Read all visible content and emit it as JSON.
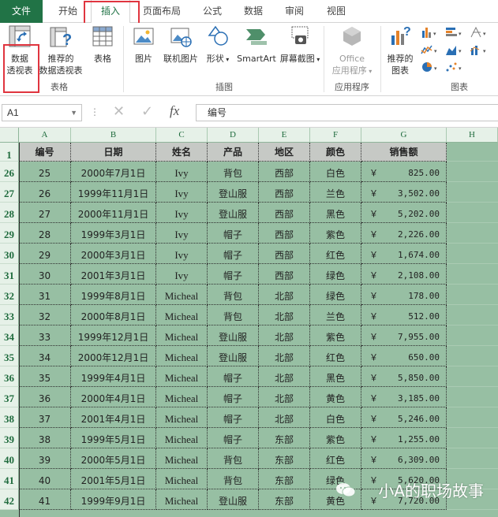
{
  "tabs": [
    {
      "label": "文件"
    },
    {
      "label": "开始"
    },
    {
      "label": "插入"
    },
    {
      "label": "页面布局"
    },
    {
      "label": "公式"
    },
    {
      "label": "数据"
    },
    {
      "label": "审阅"
    },
    {
      "label": "视图"
    }
  ],
  "ribbon": {
    "pivot_label_1": "数据",
    "pivot_label_2": "透视表",
    "rec_pivot_label_1": "推荐的",
    "rec_pivot_label_2": "数据透视表",
    "table_label": "表格",
    "group_table": "表格",
    "picture_label": "图片",
    "online_picture_label": "联机图片",
    "shapes_label": "形状",
    "smartart_label": "SmartArt",
    "screenshot_label": "屏幕截图",
    "group_illustrations": "插图",
    "office_apps_label_1": "Office",
    "office_apps_label_2": "应用程序",
    "group_apps": "应用程序",
    "rec_charts_label_1": "推荐的",
    "rec_charts_label_2": "图表",
    "group_charts": "图表"
  },
  "formula_bar": {
    "name_box": "A1",
    "fx": "fx",
    "content": "编号"
  },
  "columns": [
    "A",
    "B",
    "C",
    "D",
    "E",
    "F",
    "G",
    "H"
  ],
  "header_row": {
    "row": "1",
    "cells": [
      "编号",
      "日期",
      "姓名",
      "产品",
      "地区",
      "颜色",
      "销售额"
    ]
  },
  "rows": [
    {
      "row": "26",
      "cells": [
        "25",
        "2000年7月1日",
        "Ivy",
        "背包",
        "西部",
        "白色",
        "825.00"
      ]
    },
    {
      "row": "27",
      "cells": [
        "26",
        "1999年11月1日",
        "Ivy",
        "登山服",
        "西部",
        "兰色",
        "3,502.00"
      ]
    },
    {
      "row": "28",
      "cells": [
        "27",
        "2000年11月1日",
        "Ivy",
        "登山服",
        "西部",
        "黑色",
        "5,202.00"
      ]
    },
    {
      "row": "29",
      "cells": [
        "28",
        "1999年3月1日",
        "Ivy",
        "帽子",
        "西部",
        "紫色",
        "2,226.00"
      ]
    },
    {
      "row": "30",
      "cells": [
        "29",
        "2000年3月1日",
        "Ivy",
        "帽子",
        "西部",
        "红色",
        "1,674.00"
      ]
    },
    {
      "row": "31",
      "cells": [
        "30",
        "2001年3月1日",
        "Ivy",
        "帽子",
        "西部",
        "绿色",
        "2,108.00"
      ]
    },
    {
      "row": "32",
      "cells": [
        "31",
        "1999年8月1日",
        "Micheal",
        "背包",
        "北部",
        "绿色",
        "178.00"
      ]
    },
    {
      "row": "33",
      "cells": [
        "32",
        "2000年8月1日",
        "Micheal",
        "背包",
        "北部",
        "兰色",
        "512.00"
      ]
    },
    {
      "row": "34",
      "cells": [
        "33",
        "1999年12月1日",
        "Micheal",
        "登山服",
        "北部",
        "紫色",
        "7,955.00"
      ]
    },
    {
      "row": "35",
      "cells": [
        "34",
        "2000年12月1日",
        "Micheal",
        "登山服",
        "北部",
        "红色",
        "650.00"
      ]
    },
    {
      "row": "36",
      "cells": [
        "35",
        "1999年4月1日",
        "Micheal",
        "帽子",
        "北部",
        "黑色",
        "5,850.00"
      ]
    },
    {
      "row": "37",
      "cells": [
        "36",
        "2000年4月1日",
        "Micheal",
        "帽子",
        "北部",
        "黄色",
        "3,185.00"
      ]
    },
    {
      "row": "38",
      "cells": [
        "37",
        "2001年4月1日",
        "Micheal",
        "帽子",
        "北部",
        "白色",
        "5,246.00"
      ]
    },
    {
      "row": "39",
      "cells": [
        "38",
        "1999年5月1日",
        "Micheal",
        "帽子",
        "东部",
        "紫色",
        "1,255.00"
      ]
    },
    {
      "row": "40",
      "cells": [
        "39",
        "2000年5月1日",
        "Micheal",
        "背包",
        "东部",
        "红色",
        "6,309.00"
      ]
    },
    {
      "row": "41",
      "cells": [
        "40",
        "2001年5月1日",
        "Micheal",
        "背包",
        "东部",
        "绿色",
        "5,620.00"
      ]
    },
    {
      "row": "42",
      "cells": [
        "41",
        "1999年9月1日",
        "Micheal",
        "登山服",
        "东部",
        "黄色",
        "7,720.00"
      ]
    }
  ],
  "currency_symbol": "￥",
  "watermark": "小A的职场故事",
  "colors": {
    "excel_green": "#217346",
    "grid_bg": "#97bfa3",
    "header_cell_bg": "#c6c9c5",
    "highlight_red": "#e0353f"
  }
}
